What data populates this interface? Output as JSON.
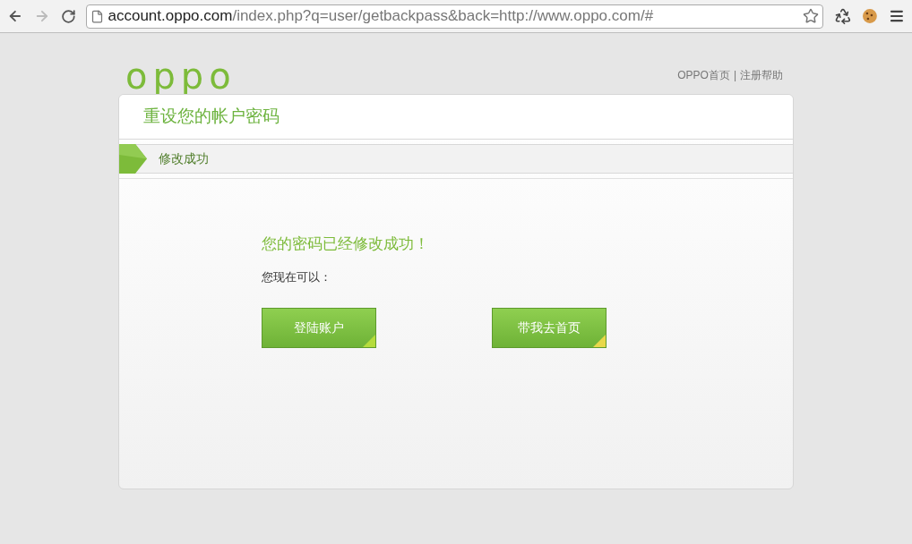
{
  "browser": {
    "url_host": "account.oppo.com",
    "url_path": "/index.php?q=user/getbackpass&back=http://www.oppo.com/#",
    "back_enabled": true,
    "forward_enabled": false
  },
  "header": {
    "logo": "oppo",
    "links": [
      {
        "label": "OPPO首页"
      },
      {
        "label": "注册帮助"
      }
    ],
    "separator": "|"
  },
  "card": {
    "title": "重设您的帐户密码",
    "step": "修改成功",
    "message": "您的密码已经修改成功！",
    "prompt": "您现在可以：",
    "buttons": [
      {
        "label": "登陆账户",
        "color": "#b5dc3c"
      },
      {
        "label": "带我去首页",
        "color": "#e8d84a"
      }
    ]
  }
}
